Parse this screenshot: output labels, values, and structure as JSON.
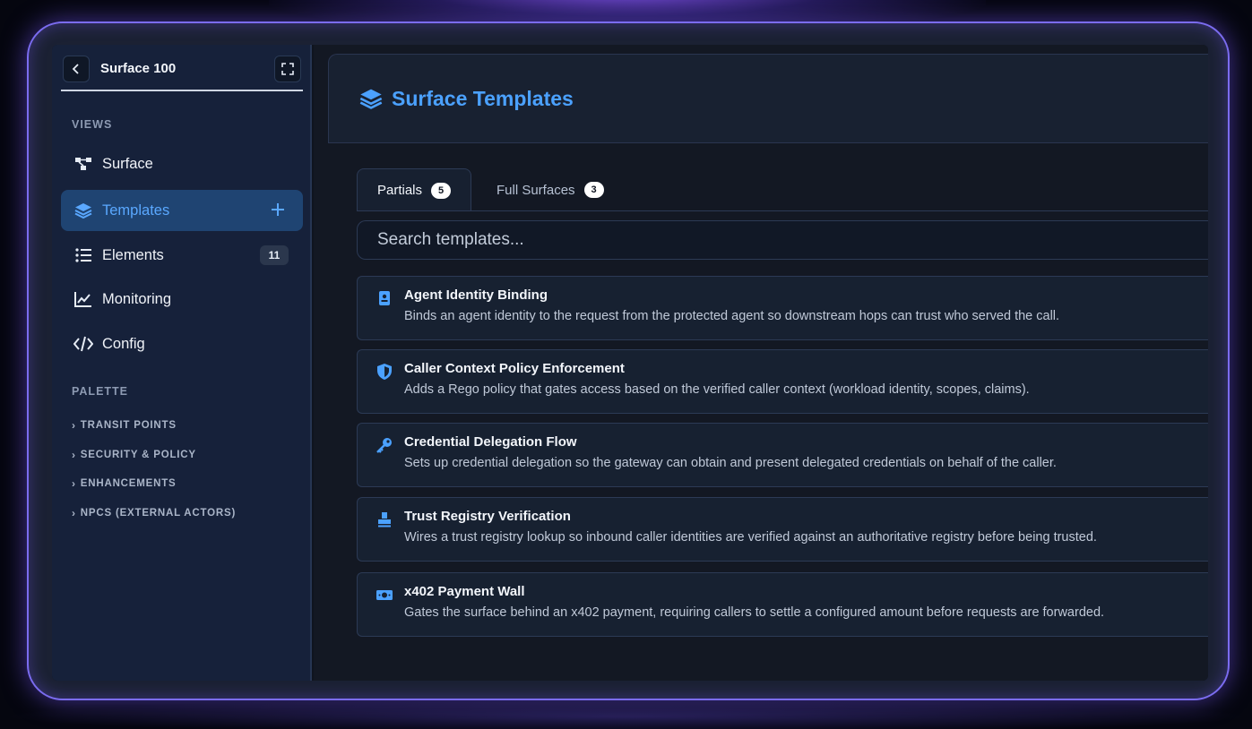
{
  "sidebar": {
    "title": "Surface 100",
    "views_label": "VIEWS",
    "items": [
      {
        "label": "Surface",
        "icon": "network-icon"
      },
      {
        "label": "Templates",
        "icon": "layers-icon",
        "active": true
      },
      {
        "label": "Elements",
        "icon": "list-icon",
        "badge": "11"
      },
      {
        "label": "Monitoring",
        "icon": "chart-line-icon"
      },
      {
        "label": "Config",
        "icon": "code-icon"
      }
    ],
    "palette_label": "PALETTE",
    "palette": [
      {
        "label": "TRANSIT POINTS"
      },
      {
        "label": "SECURITY & POLICY"
      },
      {
        "label": "ENHANCEMENTS"
      },
      {
        "label": "NPCS (EXTERNAL ACTORS)"
      }
    ]
  },
  "header": {
    "title": "Surface Templates",
    "icon": "layers-icon"
  },
  "tabs": [
    {
      "label": "Partials",
      "count": "5",
      "active": true
    },
    {
      "label": "Full Surfaces",
      "count": "3",
      "active": false
    }
  ],
  "search": {
    "placeholder": "Search templates..."
  },
  "templates": [
    {
      "title": "Agent Identity Binding",
      "desc": "Binds an agent identity to the request from the protected agent so downstream hops can trust who served the call.",
      "icon": "id-badge-icon"
    },
    {
      "title": "Caller Context Policy Enforcement",
      "desc": "Adds a Rego policy that gates access based on the verified caller context (workload identity, scopes, claims).",
      "icon": "shield-icon"
    },
    {
      "title": "Credential Delegation Flow",
      "desc": "Sets up credential delegation so the gateway can obtain and present delegated credentials on behalf of the caller.",
      "icon": "key-icon"
    },
    {
      "title": "Trust Registry Verification",
      "desc": "Wires a trust registry lookup so inbound caller identities are verified against an authoritative registry before being trusted.",
      "icon": "stamp-icon"
    },
    {
      "title": "x402 Payment Wall",
      "desc": "Gates the surface behind an x402 payment, requiring callers to settle a configured amount before requests are forwarded.",
      "icon": "money-icon"
    }
  ],
  "colors": {
    "accent": "#4ba1ff",
    "active_bg": "#1f4472",
    "frame": "#7b6cf0"
  }
}
